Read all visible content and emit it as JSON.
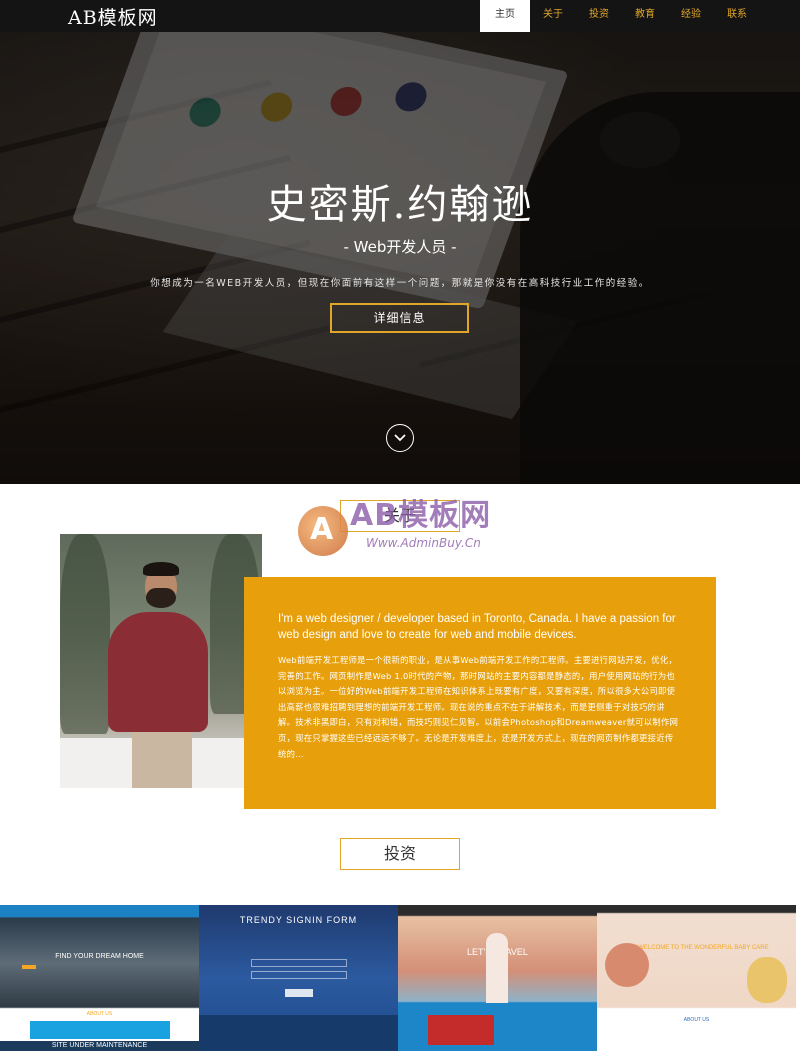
{
  "nav": {
    "brand": "AB模板网",
    "items": [
      {
        "label": "主页",
        "active": true
      },
      {
        "label": "关于",
        "active": false
      },
      {
        "label": "投资",
        "active": false
      },
      {
        "label": "教育",
        "active": false
      },
      {
        "label": "经验",
        "active": false
      },
      {
        "label": "联系",
        "active": false
      }
    ]
  },
  "hero": {
    "title": "史密斯.约翰逊",
    "subtitle": "- Web开发人员 -",
    "description": "你想成为一名WEB开发人员，但现在你面前有这样一个问题，那就是你没有在高科技行业工作的经验。",
    "button_label": "详细信息",
    "scroll_icon": "chevron-down-icon"
  },
  "about": {
    "section_title": "关于",
    "lead": "I'm a web designer / developer based in Toronto, Canada. I have a passion for web design and love to create for web and mobile devices.",
    "body": "Web前端开发工程师是一个很新的职业，是从事Web前端开发工作的工程师。主要进行网站开发，优化，完善的工作。网页制作是Web 1.0时代的产物，那时网站的主要内容都是静态的，用户使用网站的行为也以浏览为主。一位好的Web前端开发工程师在知识体系上既要有广度，又要有深度，所以很多大公司即使出高薪也很难招聘到理想的前端开发工程师。现在说的重点不在于讲解技术，而是更侧重于对技巧的讲解。技术非黑即白，只有对和错，而技巧则见仁见智。以前会Photoshop和Dreamweaver就可以制作网页，现在只掌握这些已经远远不够了。无论是开发难度上，还是开发方式上，现在的网页制作都更接近传统的…"
  },
  "watermark": {
    "text": "AB模板网",
    "url": "Www.AdminBuy.Cn",
    "logo_letter": "A"
  },
  "portfolio": {
    "section_title": "投资",
    "tiles": [
      {
        "headline": "FIND YOUR DREAM HOME",
        "footer": "ABOUT US",
        "banner": "SITE UNDER MAINTENANCE"
      },
      {
        "headline": "TRENDY SIGNIN FORM"
      },
      {
        "headline": "LET'S TRAVEL"
      },
      {
        "headline": "GET WELCOME TO THE WONDERFUL BABY CARE",
        "footer": "ABOUT US"
      }
    ]
  },
  "colors": {
    "accent": "#e7a00c",
    "nav_bg": "#141414",
    "border_accent": "#e0a62a",
    "watermark": "#8b5da8"
  }
}
